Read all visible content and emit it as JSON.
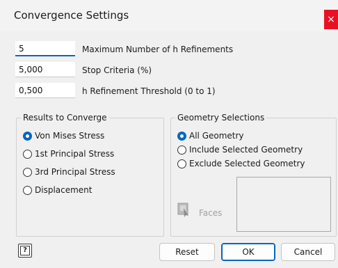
{
  "dialog": {
    "title": "Convergence Settings",
    "close_glyph": "×"
  },
  "fields": [
    {
      "value": "5",
      "label": "Maximum Number of h Refinements"
    },
    {
      "value": "5,000",
      "label": "Stop Criteria (%)"
    },
    {
      "value": "0,500",
      "label": "h Refinement Threshold (0 to 1)"
    }
  ],
  "results_group": {
    "title": "Results to Converge",
    "options": [
      {
        "label": "Von Mises Stress",
        "checked": true
      },
      {
        "label": "1st Principal Stress",
        "checked": false
      },
      {
        "label": "3rd Principal Stress",
        "checked": false
      },
      {
        "label": "Displacement",
        "checked": false
      }
    ]
  },
  "geometry_group": {
    "title": "Geometry Selections",
    "options": [
      {
        "label": "All Geometry",
        "checked": true
      },
      {
        "label": "Include Selected Geometry",
        "checked": false
      },
      {
        "label": "Exclude Selected Geometry",
        "checked": false
      }
    ],
    "faces_label": "Faces"
  },
  "footer": {
    "help_glyph": "?",
    "reset_label": "Reset",
    "ok_label": "OK",
    "cancel_label": "Cancel"
  },
  "colors": {
    "accent": "#0067c0",
    "close": "#e81123"
  },
  "icons": {
    "help": "help-icon",
    "faces": "faces-select-icon",
    "close": "close-icon"
  }
}
